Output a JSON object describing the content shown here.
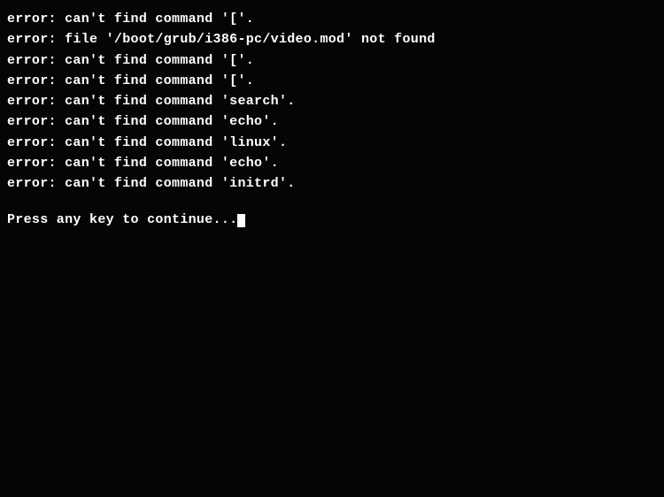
{
  "terminal": {
    "lines": [
      "error: can't find command '['.",
      "error: file '/boot/grub/i386-pc/video.mod' not found",
      "error: can't find command '['.",
      "error: can't find command '['.",
      "error: can't find command 'search'.",
      "error: can't find command 'echo'.",
      "error: can't find command 'linux'.",
      "error: can't find command 'echo'.",
      "error: can't find command 'initrd'."
    ],
    "prompt": "Press any key to continue..._"
  }
}
